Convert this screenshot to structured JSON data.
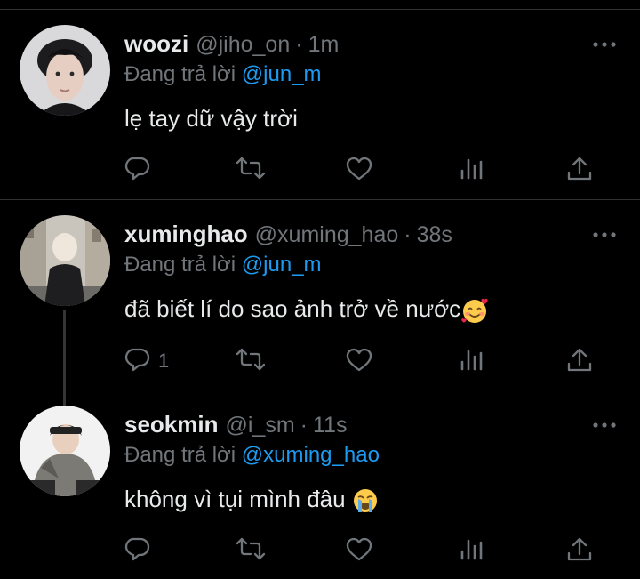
{
  "tweets": [
    {
      "display_name": "woozi",
      "handle": "@jiho_on",
      "separator": "·",
      "time": "1m",
      "replying_prefix": "Đang trả lời",
      "replying_to": "@jun_m",
      "text": "lẹ tay dữ vậy trời",
      "reply_count": "",
      "icons": [
        "reply-icon",
        "retweet-icon",
        "like-icon",
        "views-icon",
        "share-icon",
        "more-icon"
      ]
    },
    {
      "display_name": "xuminghao",
      "handle": "@xuming_hao",
      "separator": "·",
      "time": "38s",
      "replying_prefix": "Đang trả lời",
      "replying_to": "@jun_m",
      "text": "đã biết lí do sao ảnh trở về nước",
      "text_emoji": "smiling-face-with-hearts",
      "reply_count": "1",
      "icons": [
        "reply-icon",
        "retweet-icon",
        "like-icon",
        "views-icon",
        "share-icon",
        "more-icon"
      ]
    },
    {
      "display_name": "seokmin",
      "handle": "@i_sm",
      "separator": "·",
      "time": "11s",
      "replying_prefix": "Đang trả lời",
      "replying_to": "@xuming_hao",
      "text": "không vì tụi mình đâu",
      "text_emoji": "loudly-crying-face",
      "reply_count": "",
      "icons": [
        "reply-icon",
        "retweet-icon",
        "like-icon",
        "views-icon",
        "share-icon",
        "more-icon"
      ]
    }
  ],
  "colors": {
    "background": "#000000",
    "primary_text": "#e7e9ea",
    "secondary_text": "#71767b",
    "mention": "#1d9bf0",
    "divider": "#2f3336"
  }
}
